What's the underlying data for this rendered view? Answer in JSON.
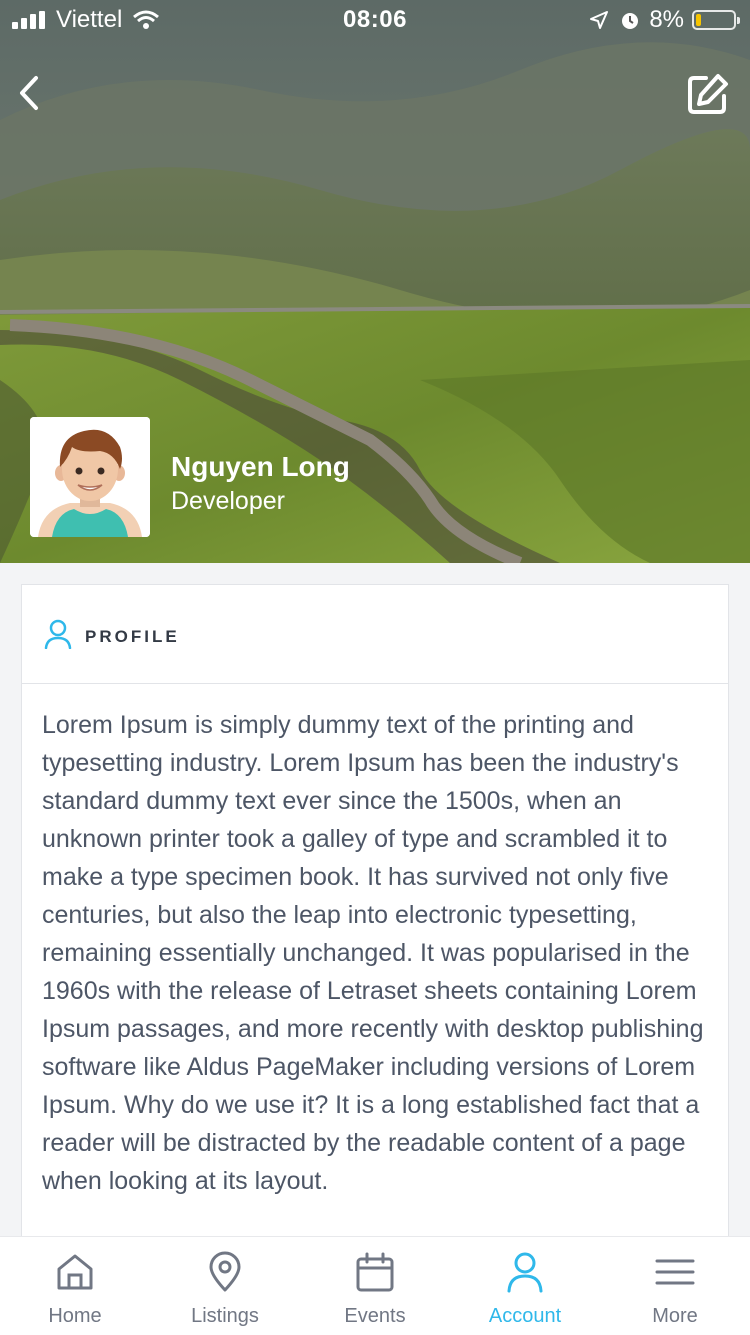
{
  "status_bar": {
    "carrier": "Viettel",
    "time": "08:06",
    "battery": "8%",
    "battery_level": 0.08
  },
  "header": {
    "back_icon": "chevron-left-icon",
    "edit_icon": "edit-icon"
  },
  "user": {
    "name": "Nguyen Long",
    "role": "Developer",
    "avatar_icon": "avatar-cartoon"
  },
  "profile_card": {
    "title": "PROFILE",
    "icon": "user-icon",
    "body": "Lorem Ipsum is simply dummy text of the printing and typesetting industry. Lorem Ipsum has been the industry's standard dummy text ever since the 1500s, when an unknown printer took a galley of type and scrambled it to make a type specimen book. It has survived not only five centuries, but also the leap into electronic typesetting, remaining essentially unchanged. It was popularised in the 1960s with the release of Letraset sheets containing Lorem Ipsum passages, and more recently with desktop publishing software like Aldus PageMaker including versions of Lorem Ipsum. Why do we use it? It is a long established fact that a reader will be distracted by the readable content of a page when looking at its layout."
  },
  "tabbar": {
    "active": "Account",
    "active_color": "#2fb8ea",
    "items": [
      {
        "label": "Home",
        "icon": "home-icon"
      },
      {
        "label": "Listings",
        "icon": "location-pin-icon"
      },
      {
        "label": "Events",
        "icon": "calendar-icon"
      },
      {
        "label": "Account",
        "icon": "user-icon"
      },
      {
        "label": "More",
        "icon": "menu-icon"
      }
    ]
  }
}
